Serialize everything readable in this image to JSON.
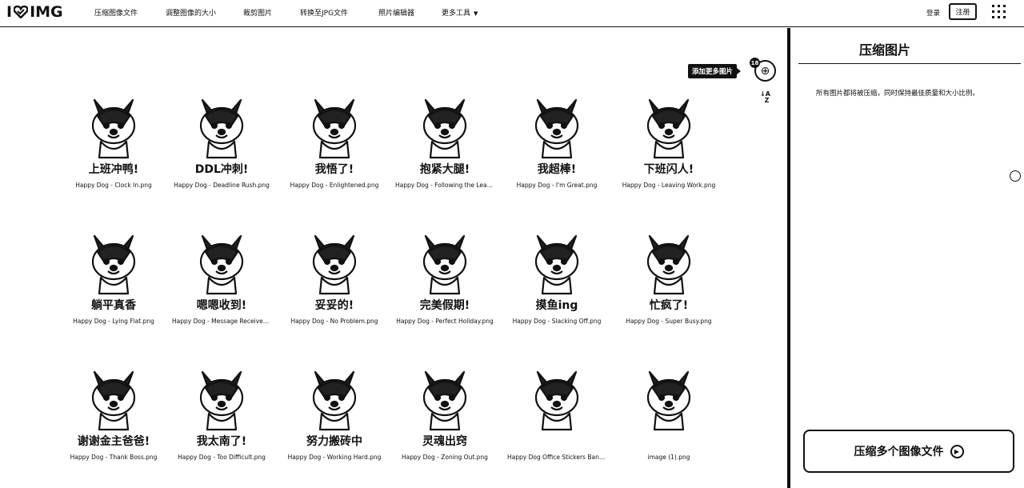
{
  "header": {
    "logo_text_left": "I",
    "logo_text_right": "IMG",
    "nav": [
      {
        "label": "压缩图像文件"
      },
      {
        "label": "调整图像的大小"
      },
      {
        "label": "裁剪图片"
      },
      {
        "label": "转换至JPG文件"
      },
      {
        "label": "照片编辑器"
      },
      {
        "label": "更多工具"
      }
    ],
    "login_label": "登录",
    "signup_label": "注册"
  },
  "workspace": {
    "add_more_label": "添加更多图片",
    "add_count": "18",
    "sort_label_a": "A",
    "sort_label_z": "Z",
    "files": [
      {
        "name": "Happy Dog - Clock In.png",
        "caption": "上班冲鸭!"
      },
      {
        "name": "Happy Dog - Deadline Rush.png",
        "caption": "DDL冲刺!"
      },
      {
        "name": "Happy Dog - Enlightened.png",
        "caption": "我悟了!"
      },
      {
        "name": "Happy Dog - Following the Lead…",
        "caption": "抱紧大腿!"
      },
      {
        "name": "Happy Dog - I'm Great.png",
        "caption": "我超棒!"
      },
      {
        "name": "Happy Dog - Leaving Work.png",
        "caption": "下班闪人!"
      },
      {
        "name": "Happy Dog - Lying Flat.png",
        "caption": "躺平真香"
      },
      {
        "name": "Happy Dog - Message Received.…",
        "caption": "嗯嗯收到!"
      },
      {
        "name": "Happy Dog - No Problem.png",
        "caption": "妥妥的!"
      },
      {
        "name": "Happy Dog - Perfect Holiday.png",
        "caption": "完美假期!"
      },
      {
        "name": "Happy Dog - Slacking Off.png",
        "caption": "摸鱼ing"
      },
      {
        "name": "Happy Dog - Super Busy.png",
        "caption": "忙疯了!"
      },
      {
        "name": "Happy Dog - Thank Boss.png",
        "caption": "谢谢金主爸爸!"
      },
      {
        "name": "Happy Dog - Too Difficult.png",
        "caption": "我太南了!"
      },
      {
        "name": "Happy Dog - Working Hard.png",
        "caption": "努力搬砖中"
      },
      {
        "name": "Happy Dog - Zoning Out.png",
        "caption": "灵魂出窍"
      },
      {
        "name": "Happy Dog Office Stickers Bann…",
        "caption": ""
      },
      {
        "name": "image (1).png",
        "caption": ""
      }
    ]
  },
  "sidebar": {
    "title": "压缩图片",
    "description": "所有图片都将被压缩，同时保持最佳质量和大小比例。",
    "compress_label": "压缩多个图像文件"
  }
}
